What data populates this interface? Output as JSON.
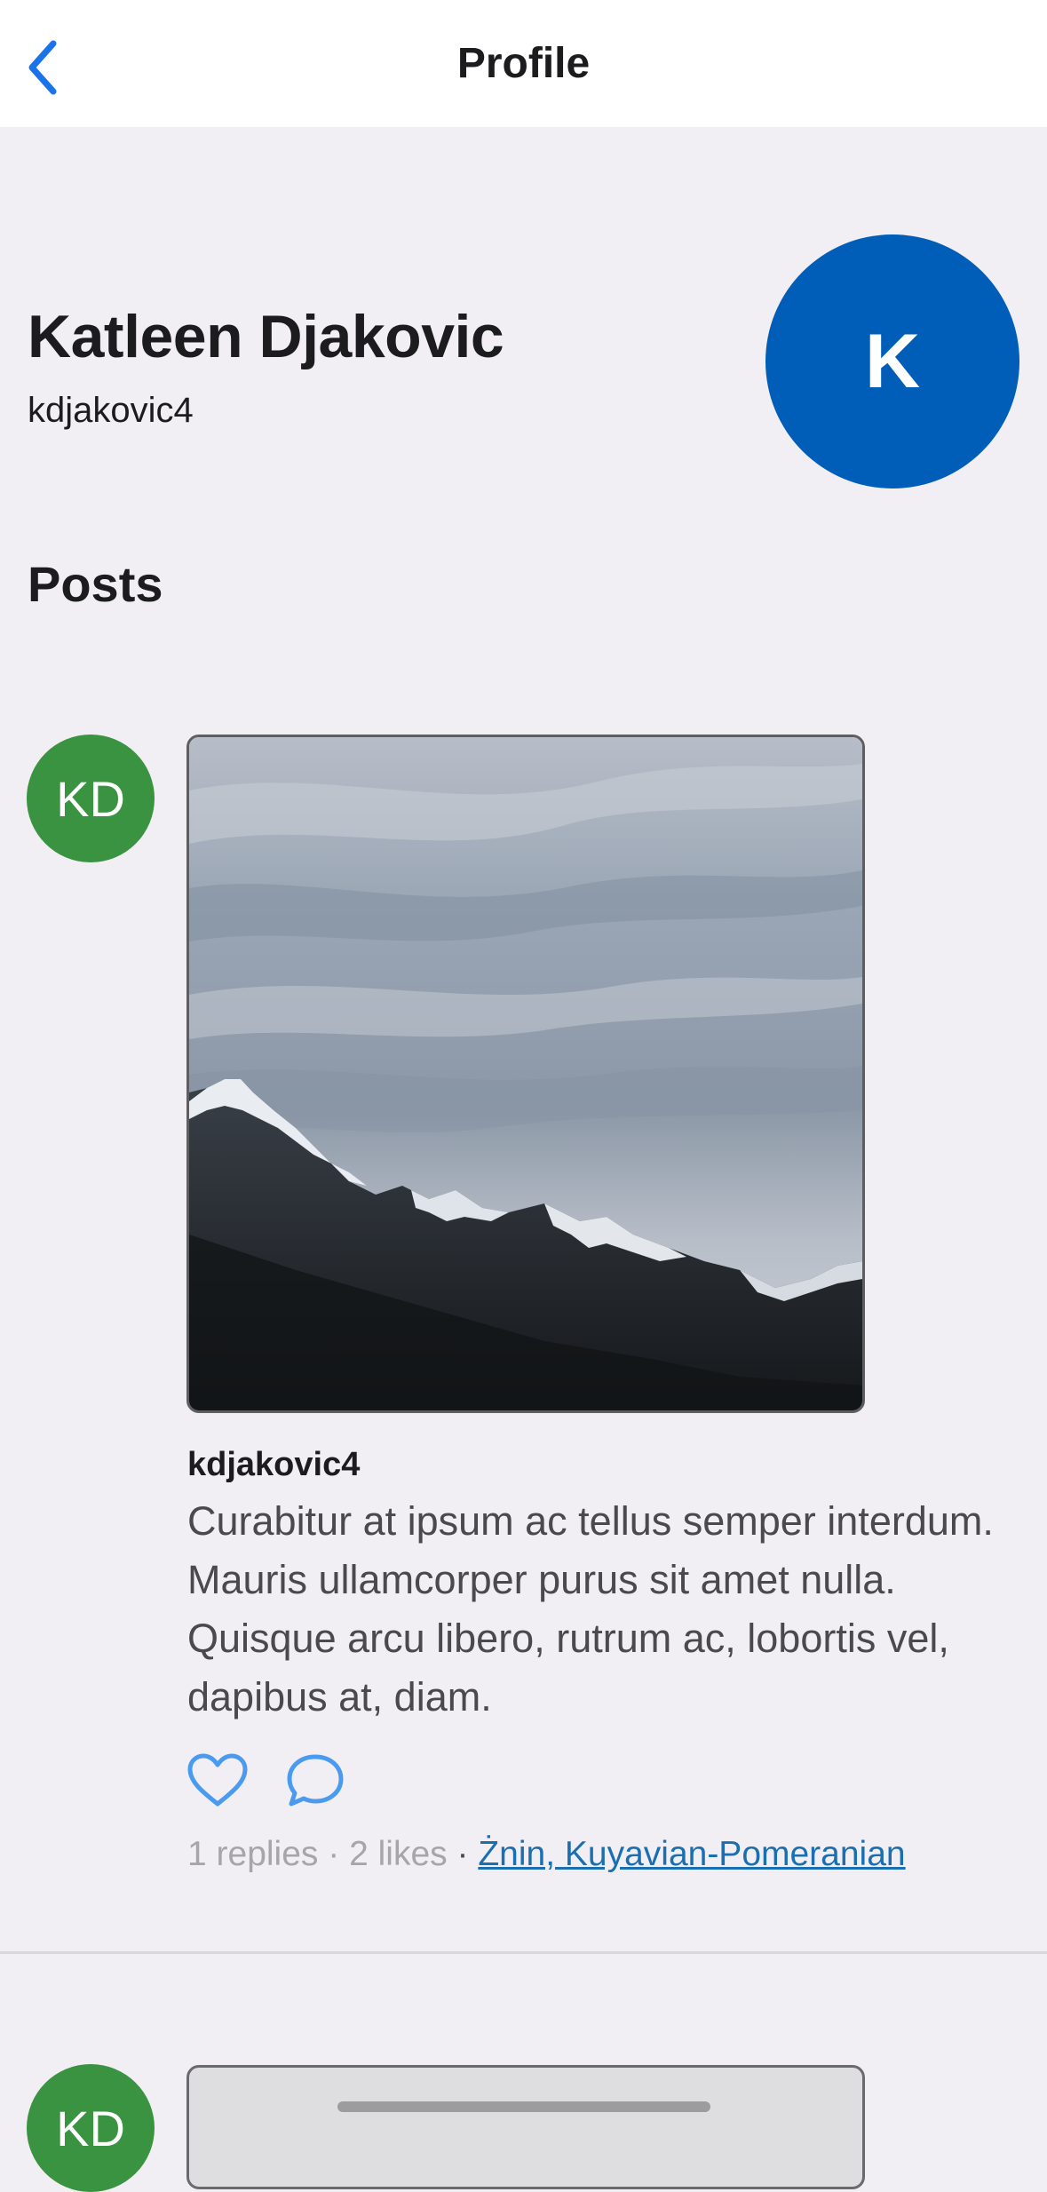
{
  "nav": {
    "title": "Profile",
    "back_icon": "chevron-left-icon",
    "accent_color": "#1a73e8"
  },
  "profile": {
    "name": "Katleen Djakovic",
    "handle": "kdjakovic4",
    "avatar_initial": "K",
    "avatar_color": "#005eb8"
  },
  "posts_section": {
    "title": "Posts"
  },
  "posts": [
    {
      "avatar_initials": "KD",
      "avatar_color": "#3a9340",
      "image": "snowy-mountain-range-photo",
      "username": "kdjakovic4",
      "text": "Curabitur at ipsum ac tellus semper interdum. Mauris ullamcorper purus sit amet nulla. Quisque arcu libero, rutrum ac, lobortis vel, dapibus at, diam.",
      "like_icon": "heart-icon",
      "reply_icon": "comment-bubble-icon",
      "replies": "1 replies",
      "likes": "2 likes",
      "location": "Żnin, Kuyavian-Pomeranian",
      "separator": "·"
    },
    {
      "avatar_initials": "KD",
      "avatar_color": "#3a9340"
    }
  ]
}
